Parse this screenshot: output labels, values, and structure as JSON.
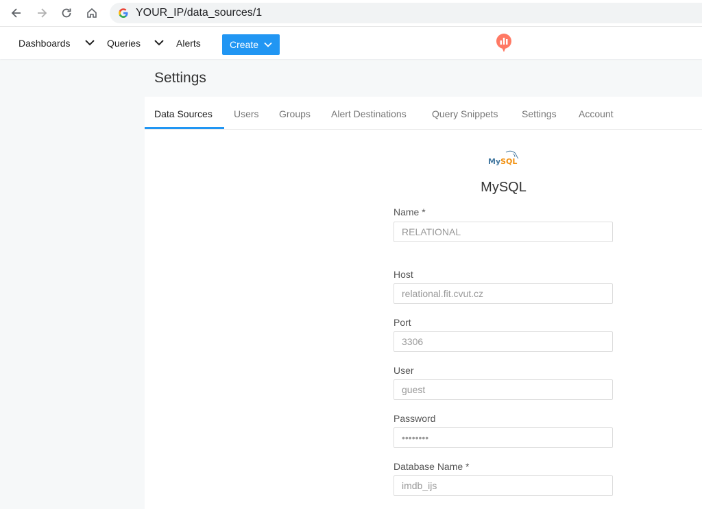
{
  "browser": {
    "url": "YOUR_IP/data_sources/1",
    "back_icon": "arrow-left-icon",
    "forward_icon": "arrow-right-icon",
    "reload_icon": "reload-icon",
    "home_icon": "home-icon"
  },
  "topnav": {
    "items": [
      {
        "label": "Dashboards"
      },
      {
        "label": "Queries"
      },
      {
        "label": "Alerts"
      }
    ],
    "create_label": "Create",
    "brand_color": "#ff7964",
    "accent_color": "#2196f3"
  },
  "page": {
    "title": "Settings"
  },
  "tabs": [
    {
      "label": "Data Sources",
      "active": true
    },
    {
      "label": "Users"
    },
    {
      "label": "Groups"
    },
    {
      "label": "Alert Destinations"
    },
    {
      "label": "Query Snippets"
    },
    {
      "label": "Settings"
    },
    {
      "label": "Account"
    }
  ],
  "datasource": {
    "logo_text": "MySQL",
    "type_name": "MySQL",
    "fields": [
      {
        "label": "Name *",
        "value": "RELATIONAL"
      },
      {
        "label": "Host",
        "value": "relational.fit.cvut.cz"
      },
      {
        "label": "Port",
        "value": "3306"
      },
      {
        "label": "User",
        "value": "guest"
      },
      {
        "label": "Password",
        "value": "••••••••"
      },
      {
        "label": "Database Name *",
        "value": "imdb_ijs"
      }
    ]
  }
}
